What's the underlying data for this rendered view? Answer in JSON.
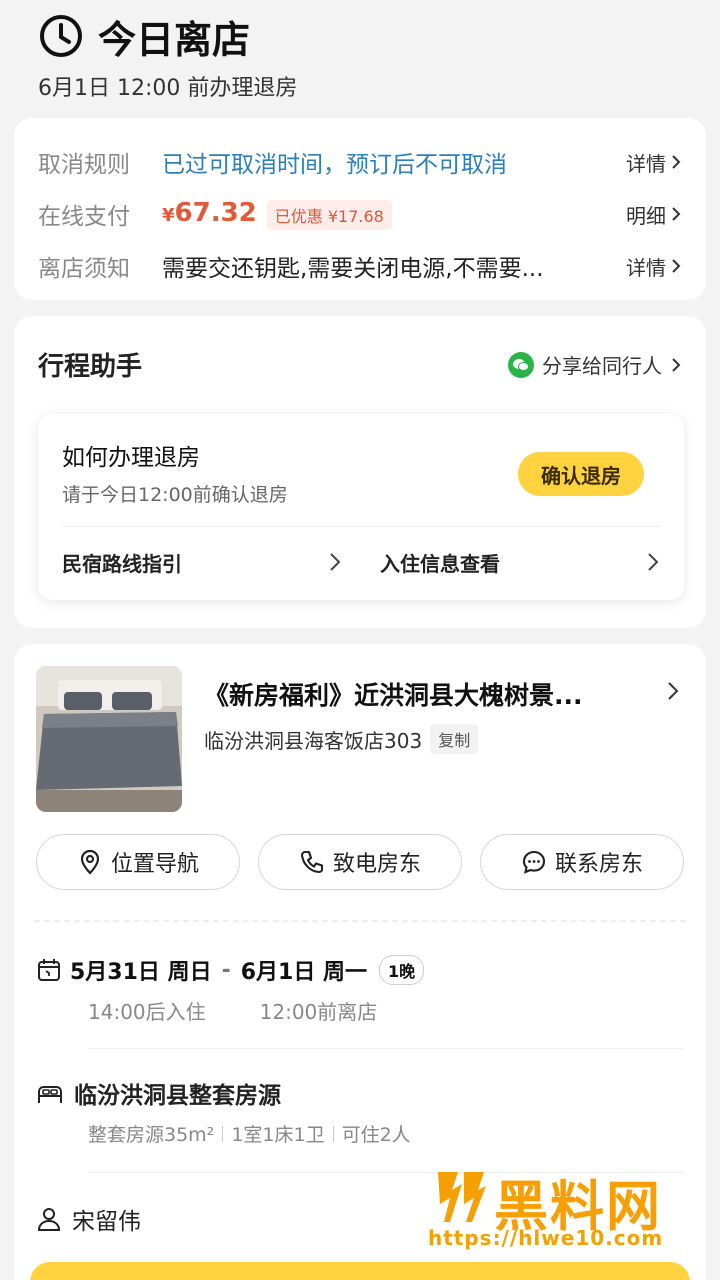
{
  "header": {
    "title": "今日离店",
    "subtitle": "6月1日 12:00 前办理退房"
  },
  "info": {
    "cancel_label": "取消规则",
    "cancel_value": "已过可取消时间，预订后不可取消",
    "cancel_link": "详情",
    "pay_label": "在线支付",
    "price_symbol": "¥",
    "price": "67.32",
    "discount": "已优惠 ¥17.68",
    "pay_link": "明细",
    "notice_label": "离店须知",
    "notice_value": "需要交还钥匙,需要关闭电源,不需要...",
    "notice_link": "详情"
  },
  "trip": {
    "title": "行程助手",
    "share": "分享给同行人",
    "how_title": "如何办理退房",
    "how_sub": "请于今日12:00前确认退房",
    "confirm_btn": "确认退房",
    "route_link": "民宿路线指引",
    "checkin_info_link": "入住信息查看"
  },
  "listing": {
    "name": "《新房福利》近洪洞县大槐树景...",
    "address": "临汾洪洞县海客饭店303",
    "copy_btn": "复制",
    "actions": {
      "navigate": "位置导航",
      "call": "致电房东",
      "contact": "联系房东"
    }
  },
  "stay": {
    "checkin_date": "5月31日 周日",
    "dash": "-",
    "checkout_date": "6月1日 周一",
    "nights": "1晚",
    "checkin_time": "14:00后入住",
    "checkout_time": "12:00前离店",
    "room_title": "临汾洪洞县整套房源",
    "room_type": "整套房源35m²",
    "room_layout": "1室1床1卫",
    "room_capacity": "可住2人",
    "guest_name": "宋留伟"
  },
  "watermark": {
    "text": "黑料网",
    "url": "https://hlwe10.com"
  },
  "colors": {
    "accent_yellow": "#ffd23f",
    "link_blue": "#2c7fb8",
    "price_red": "#e05a3a",
    "watermark_orange": "#f5a000"
  }
}
